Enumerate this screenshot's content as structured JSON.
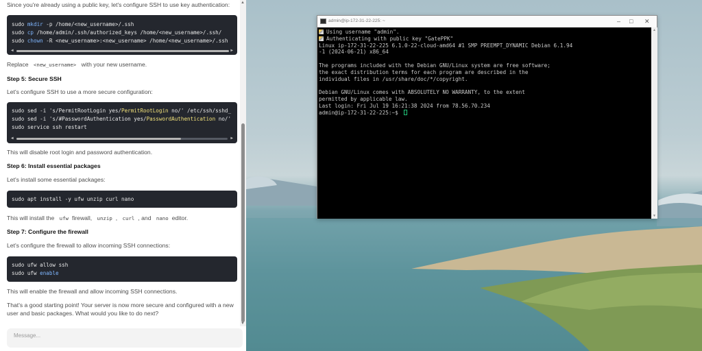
{
  "chat": {
    "intro": "Since you're already using a public key, let's configure SSH to use key authentication:",
    "code1": [
      {
        "parts": [
          {
            "t": "sudo "
          },
          {
            "t": "mkdir",
            "c": "kw"
          },
          {
            "t": " -p /home/<new_username>/.ssh"
          }
        ]
      },
      {
        "parts": [
          {
            "t": "sudo "
          },
          {
            "t": "cp",
            "c": "kw"
          },
          {
            "t": " /home/admin/.ssh/authorized_keys /home/<new_username>/.ssh/"
          }
        ]
      },
      {
        "parts": [
          {
            "t": "sudo "
          },
          {
            "t": "chown",
            "c": "kw"
          },
          {
            "t": " -R <new_username>:<new_username> /home/<new_username>/.ssh"
          }
        ]
      }
    ],
    "replace_pre": "Replace",
    "replace_code": "<new_username>",
    "replace_post": "with your new username.",
    "step5_heading": "Step 5: Secure SSH",
    "step5_intro": "Let's configure SSH to use a more secure configuration:",
    "code2": [
      {
        "parts": [
          {
            "t": "sudo sed -i 's/PermitRootLogin yes/"
          },
          {
            "t": "PermitRootLogin",
            "c": "hl"
          },
          {
            "t": " no/' /etc/ssh/sshd_"
          }
        ]
      },
      {
        "parts": [
          {
            "t": "sudo sed -i 's/#PasswordAuthentication yes/"
          },
          {
            "t": "PasswordAuthentication",
            "c": "hl"
          },
          {
            "t": " no/'"
          }
        ]
      },
      {
        "parts": [
          {
            "t": "sudo service ssh restart"
          }
        ]
      }
    ],
    "step5_after": "This will disable root login and password authentication.",
    "step6_heading": "Step 6: Install essential packages",
    "step6_intro": "Let's install some essential packages:",
    "code3": [
      {
        "parts": [
          {
            "t": "sudo apt install -y ufw unzip curl nano"
          }
        ]
      }
    ],
    "install_text": {
      "pre": "This will install the",
      "c1": "ufw",
      "mid1": "firewall,",
      "c2": "unzip",
      "comma": ",",
      "c3": "curl",
      "and": ", and",
      "c4": "nano",
      "post": "editor."
    },
    "step7_heading": "Step 7: Configure the firewall",
    "step7_intro": "Let's configure the firewall to allow incoming SSH connections:",
    "code4": [
      {
        "parts": [
          {
            "t": "sudo ufw allow ssh"
          }
        ]
      },
      {
        "parts": [
          {
            "t": "sudo ufw "
          },
          {
            "t": "enable",
            "c": "kw"
          }
        ]
      }
    ],
    "step7_after": "This will enable the firewall and allow incoming SSH connections.",
    "closing_1": "That's a good starting point! Your server is now more secure and configured with a new",
    "closing_2": "user and basic packages. What would you like to do next?",
    "message_placeholder": "Message..."
  },
  "terminal": {
    "title": "admin@ip-172-31-22-225: ~",
    "lines": [
      {
        "text": "Using username \"admin\".",
        "key": true
      },
      {
        "text": "Authenticating with public key \"GatePPK\"",
        "key": true
      },
      {
        "text": "Linux ip-172-31-22-225 6.1.0-22-cloud-amd64 #1 SMP PREEMPT_DYNAMIC Debian 6.1.94"
      },
      {
        "text": "-1 (2024-06-21) x86_64"
      },
      {
        "text": ""
      },
      {
        "text": "The programs included with the Debian GNU/Linux system are free software;"
      },
      {
        "text": "the exact distribution terms for each program are described in the"
      },
      {
        "text": "individual files in /usr/share/doc/*/copyright."
      },
      {
        "text": ""
      },
      {
        "text": "Debian GNU/Linux comes with ABSOLUTELY NO WARRANTY, to the extent"
      },
      {
        "text": "permitted by applicable law."
      },
      {
        "text": "Last login: Fri Jul 19 16:21:38 2024 from 78.56.70.234"
      },
      {
        "text": "admin@ip-172-31-22-225:~$ ",
        "cursor": true
      }
    ]
  }
}
